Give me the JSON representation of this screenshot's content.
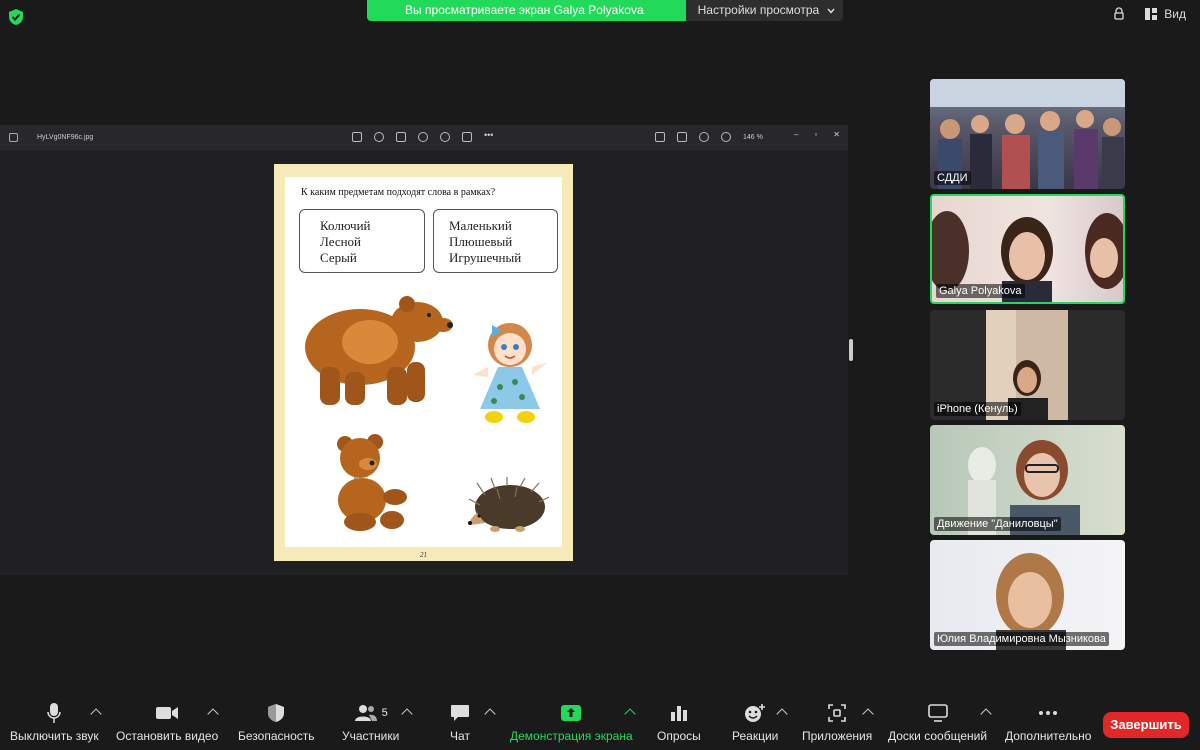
{
  "banner": {
    "message": "Вы просматриваете экран Galya Polyakova",
    "view_options": "Настройки просмотра"
  },
  "top_right": {
    "view_label": "Вид"
  },
  "viewer": {
    "filename": "HyLVg0NF96c.jpg",
    "zoom": "146 %"
  },
  "page": {
    "question": "К каким предметам подходят слова в рамках?",
    "box_left": [
      "Колючий",
      "Лесной",
      "Серый"
    ],
    "box_right": [
      "Маленький",
      "Плюшевый",
      "Игрушечный"
    ],
    "page_number": "21"
  },
  "participants": [
    {
      "name": "СДДИ"
    },
    {
      "name": "Galya Polyakova"
    },
    {
      "name": "iPhone (Кенуль)"
    },
    {
      "name": "Движение \"Даниловцы\""
    },
    {
      "name": "Юлия Владимировна Мызникова"
    }
  ],
  "toolbar": {
    "mute": "Выключить звук",
    "stop_video": "Остановить видео",
    "security": "Безопасность",
    "participants": "Участники",
    "participants_count": "5",
    "chat": "Чат",
    "share": "Демонстрация экрана",
    "polls": "Опросы",
    "reactions": "Реакции",
    "apps": "Приложения",
    "whiteboards": "Доски сообщений",
    "more": "Дополнительно",
    "end": "Завершить"
  },
  "colors": {
    "accent_green": "#23d959",
    "end_red": "#e02828"
  }
}
